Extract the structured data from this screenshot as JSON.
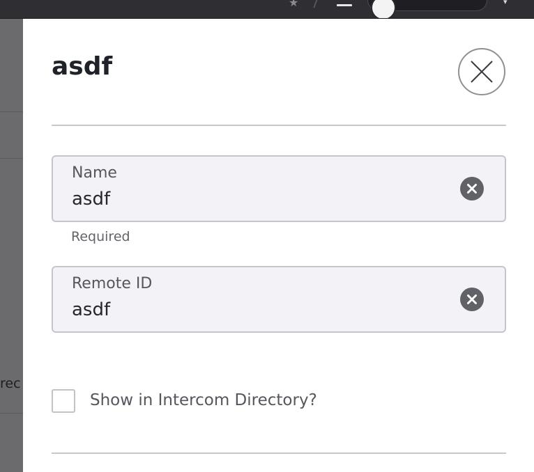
{
  "topbar": {
    "star_icon": "star-icon",
    "menu_icon": "hamburger-menu-icon",
    "avatar_icon": "avatar",
    "caret_icon": "chevron-down-icon"
  },
  "background": {
    "fragment_text": "rec"
  },
  "panel": {
    "title": "asdf",
    "close_icon": "close-icon"
  },
  "form": {
    "name": {
      "label": "Name",
      "value": "asdf",
      "helper": "Required",
      "clear_icon": "clear-icon"
    },
    "remote_id": {
      "label": "Remote ID",
      "value": "asdf",
      "clear_icon": "clear-icon"
    },
    "show_in_directory": {
      "label": "Show in Intercom Directory?",
      "checked": false
    }
  },
  "colors": {
    "field_background": "#f3f3f7",
    "clear_icon": "#616168",
    "title_text": "#1f2329"
  }
}
